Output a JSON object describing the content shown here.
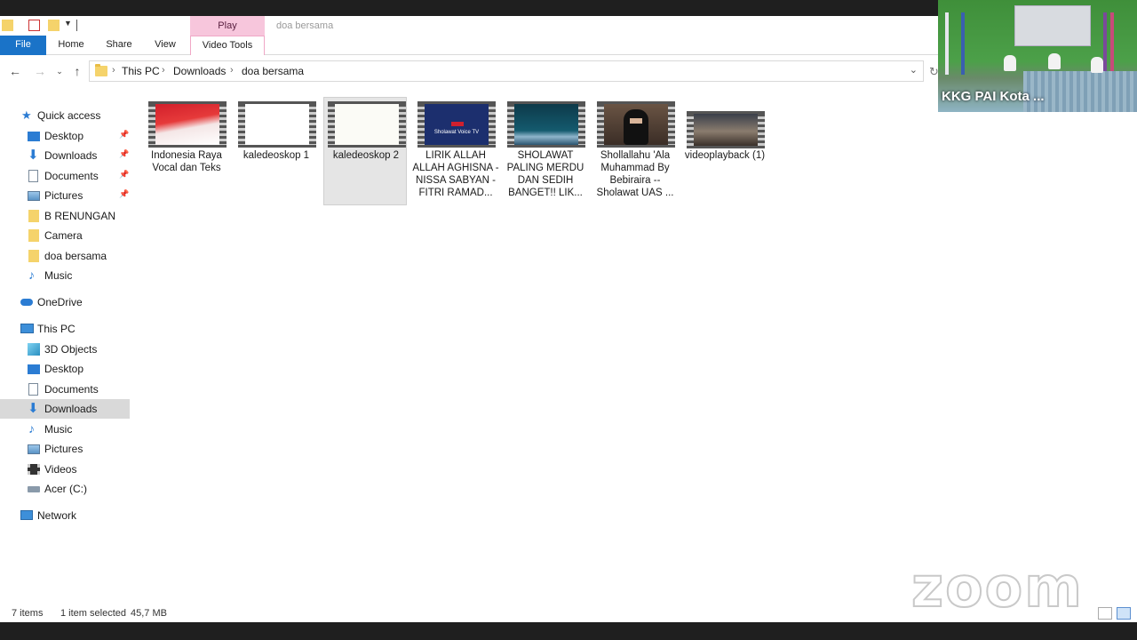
{
  "ribbon": {
    "context_tab": "Play",
    "window_title": "doa bersama",
    "tabs": [
      "File",
      "Home",
      "Share",
      "View",
      "Video Tools"
    ]
  },
  "address": {
    "breadcrumbs": [
      "This PC",
      "Downloads",
      "doa bersama"
    ]
  },
  "nav": {
    "quick_access": "Quick access",
    "quick_items": [
      "Desktop",
      "Downloads",
      "Documents",
      "Pictures",
      "B RENUNGAN",
      "Camera",
      "doa bersama",
      "Music"
    ],
    "onedrive": "OneDrive",
    "this_pc": "This PC",
    "pc_items": [
      "3D Objects",
      "Desktop",
      "Documents",
      "Downloads",
      "Music",
      "Pictures",
      "Videos",
      "Acer (C:)"
    ],
    "network": "Network",
    "selected": "Downloads"
  },
  "files": [
    {
      "name": "Indonesia Raya Vocal dan Teks",
      "thumb": "flag"
    },
    {
      "name": "kaledeoskop 1",
      "thumb": "blank"
    },
    {
      "name": "kaledeoskop 2",
      "thumb": "blank",
      "selected": true
    },
    {
      "name": "LIRIK ALLAH ALLAH AGHISNA - NISSA SABYAN - FITRI  RAMAD...",
      "thumb": "tv",
      "thumb_text": "Sholawat Voice TV"
    },
    {
      "name": "SHOLAWAT PALING MERDU DAN SEDIH BANGET!! LIK...",
      "thumb": "sea"
    },
    {
      "name": "Shollallahu 'Ala Muhammad By Bebiraira -- Sholawat UAS ...",
      "thumb": "face"
    },
    {
      "name": "videoplayback (1)",
      "thumb": "sunset"
    }
  ],
  "status": {
    "items": "7 items",
    "selection": "1 item selected",
    "size": "45,7 MB"
  },
  "zoom": {
    "participant": "KKG PAI Kota ...",
    "watermark": "zoom"
  }
}
